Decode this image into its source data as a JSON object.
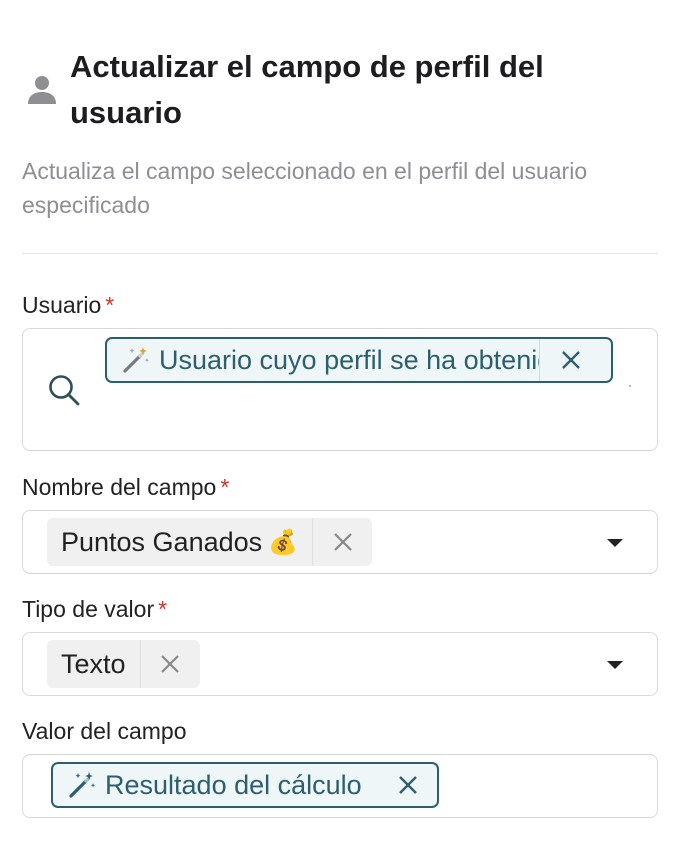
{
  "header": {
    "icon": "user-icon",
    "title": "Actualizar el campo de perfil del usuario",
    "description": "Actualiza el campo seleccionado en el perfil del usuario especificado"
  },
  "fields": {
    "user": {
      "label": "Usuario",
      "required_mark": "*",
      "chip_text": "Usuario cuyo perfil se ha obtenido",
      "icon": "search-icon"
    },
    "field_name": {
      "label": "Nombre del campo",
      "required_mark": "*",
      "selected": "Puntos Ganados",
      "emoji": "💰"
    },
    "value_type": {
      "label": "Tipo de valor",
      "required_mark": "*",
      "selected": "Texto"
    },
    "field_value": {
      "label": "Valor del campo",
      "chip_text": "Resultado del cálculo"
    }
  },
  "colors": {
    "accent": "#2c5f6e",
    "required": "#d0342c",
    "muted_text": "#8e8e93"
  }
}
